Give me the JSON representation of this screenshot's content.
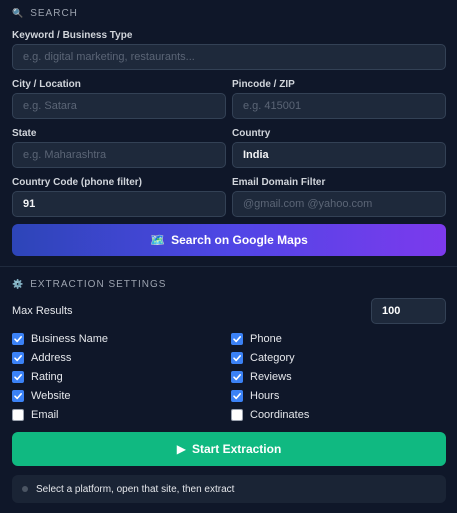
{
  "search": {
    "header": "SEARCH",
    "keyword": {
      "label": "Keyword / Business Type",
      "placeholder": "e.g. digital marketing, restaurants...",
      "value": ""
    },
    "city": {
      "label": "City / Location",
      "placeholder": "e.g. Satara",
      "value": ""
    },
    "pincode": {
      "label": "Pincode / ZIP",
      "placeholder": "e.g. 415001",
      "value": ""
    },
    "state": {
      "label": "State",
      "placeholder": "e.g. Maharashtra",
      "value": ""
    },
    "country": {
      "label": "Country",
      "placeholder": "",
      "value": "India"
    },
    "country_code": {
      "label": "Country Code (phone filter)",
      "placeholder": "",
      "value": "91"
    },
    "email_domain": {
      "label": "Email Domain Filter",
      "placeholder": "@gmail.com @yahoo.com",
      "value": ""
    },
    "button_label": "Search on Google Maps",
    "button_icon": "map-icon"
  },
  "extraction": {
    "header": "EXTRACTION SETTINGS",
    "max_results_label": "Max Results",
    "max_results_value": "100",
    "fields": [
      {
        "label": "Business Name",
        "checked": true
      },
      {
        "label": "Phone",
        "checked": true
      },
      {
        "label": "Address",
        "checked": true
      },
      {
        "label": "Category",
        "checked": true
      },
      {
        "label": "Rating",
        "checked": true
      },
      {
        "label": "Reviews",
        "checked": true
      },
      {
        "label": "Website",
        "checked": true
      },
      {
        "label": "Hours",
        "checked": true
      },
      {
        "label": "Email",
        "checked": false
      },
      {
        "label": "Coordinates",
        "checked": false
      }
    ],
    "start_label": "Start Extraction"
  },
  "status": {
    "message": "Select a platform, open that site, then extract"
  },
  "colors": {
    "background": "#0f1729",
    "input_bg": "#1e293b",
    "accent_blue": "#3b82f6",
    "start_green": "#10b981",
    "gradient_start": "#2d45b8",
    "gradient_end": "#7c3aed"
  }
}
